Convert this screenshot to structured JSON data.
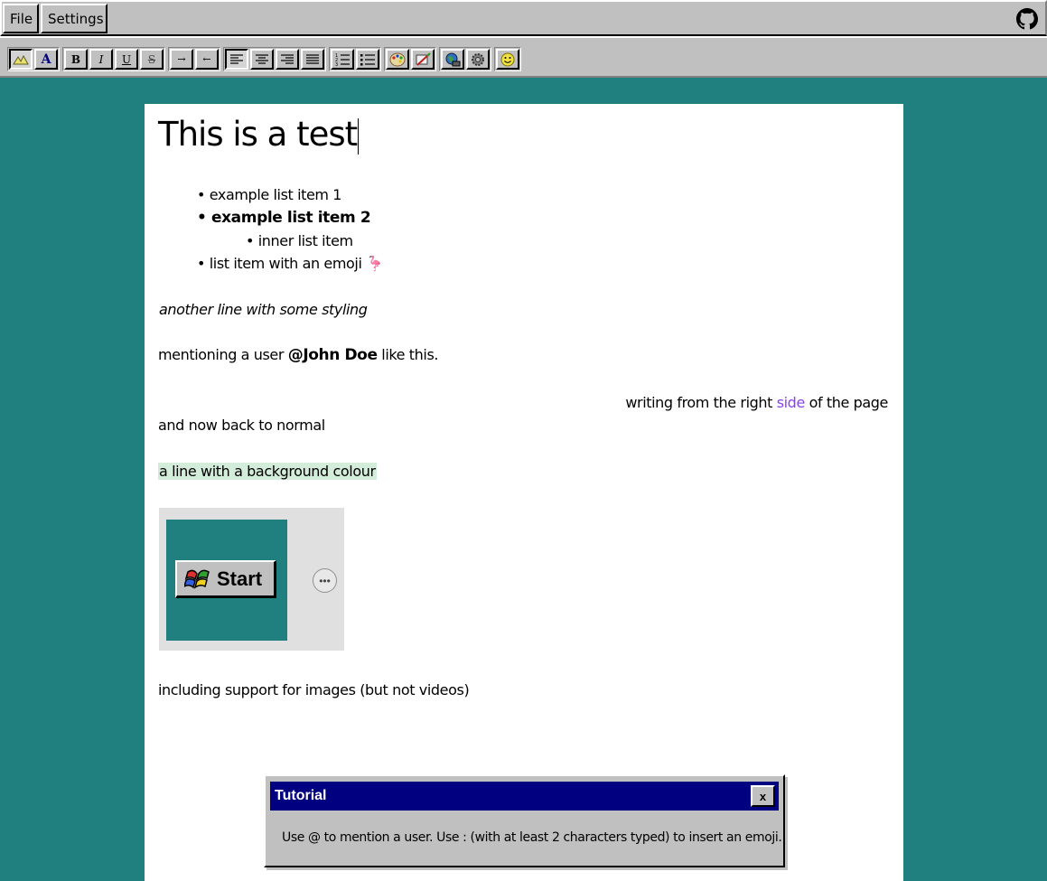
{
  "menubar": {
    "file_label": "File",
    "settings_label": "Settings",
    "github_icon": "github-icon"
  },
  "toolbar": {
    "buttons": [
      "highlight-color",
      "font-color",
      "bold",
      "italic",
      "underline",
      "strikethrough",
      "indent",
      "outdent",
      "align-left",
      "align-center",
      "align-right",
      "justify",
      "ordered-list",
      "unordered-list",
      "insert-image",
      "clear-format",
      "insert-link",
      "insert-media",
      "insert-emoji"
    ],
    "bold_glyph": "B",
    "italic_glyph": "I",
    "underline_glyph": "U",
    "strike_glyph": "S",
    "font_color_glyph": "A",
    "indent_glyph": "→",
    "outdent_glyph": "←",
    "emoji_glyph": "☺"
  },
  "document": {
    "title": "This is a test",
    "list": {
      "item1": "example list item 1",
      "item2": "example list item 2",
      "inner": "inner list item",
      "item3": "list item with an emoji",
      "item3_emoji": "🦩"
    },
    "styled_line": "another line with some styling",
    "mention": {
      "before": "mentioning a user ",
      "user": "@John Doe",
      "after": " like this."
    },
    "right_line": {
      "before": "writing from the right ",
      "highlight": "side",
      "after": " of the page"
    },
    "normal_line": "and now back to normal",
    "bg_line": "a line with a background colour",
    "image": {
      "start_label": "Start",
      "more_label": "•••"
    },
    "images_line": "including support for images (but not videos)"
  },
  "dialog": {
    "title": "Tutorial",
    "close_label": "x",
    "body": "Use @ to mention a user. Use : (with at least 2 characters typed) to insert an emoji."
  },
  "colors": {
    "desktop": "#208080",
    "chrome": "#c0c0c0",
    "title_bar": "#000080",
    "highlight_text": "#8a3ff0",
    "line_background": "#d4edda"
  }
}
